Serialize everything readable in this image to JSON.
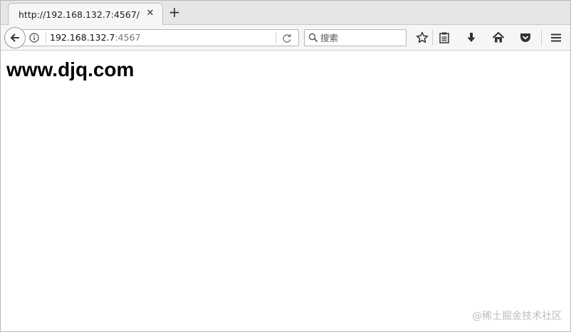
{
  "tab": {
    "title": "http://192.168.132.7:4567/",
    "close_glyph": "✕",
    "new_tab_glyph": "+"
  },
  "navbar": {
    "url_host": "192.168.132.7",
    "url_port": ":4567",
    "search_placeholder": "搜索",
    "icons": [
      "back-arrow-icon",
      "info-icon",
      "reload-icon",
      "search-icon",
      "bookmark-star-icon",
      "reading-list-icon",
      "download-icon",
      "home-icon",
      "pocket-icon",
      "menu-icon"
    ]
  },
  "page": {
    "heading": "www.djq.com"
  },
  "watermark": "@稀土掘金技术社区"
}
